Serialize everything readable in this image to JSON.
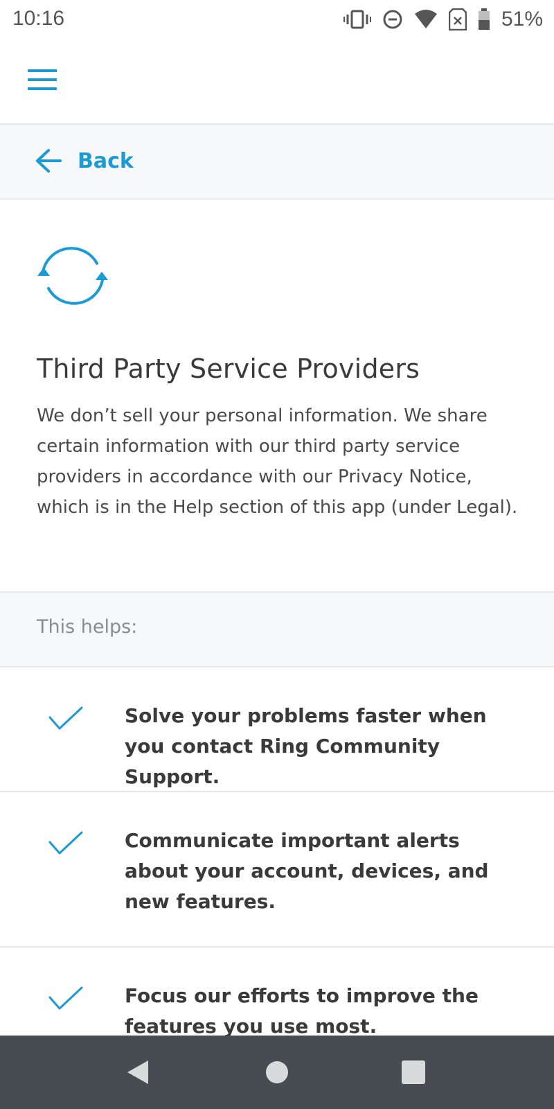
{
  "status_bar": {
    "time": "10:16",
    "battery": "51%",
    "icons": [
      "vibrate-icon",
      "do-not-disturb-icon",
      "wifi-icon",
      "no-sim-icon",
      "battery-icon"
    ]
  },
  "app_bar": {
    "menu_icon": "hamburger-menu-icon"
  },
  "back_bar": {
    "label": "Back",
    "icon": "arrow-left-icon"
  },
  "intro": {
    "icon": "sync-icon",
    "title": "Third Party Service Providers",
    "description": "We don’t sell your personal information. We share certain information with our third party service providers in accordance with our Privacy Notice, which is in the Help section of this app (under Legal)."
  },
  "helps": {
    "label": "This helps:",
    "items": [
      {
        "text": "Solve your problems faster when you contact Ring Community Support.",
        "icon": "checkmark-icon"
      },
      {
        "text": "Communicate important alerts about your account, devices, and new features.",
        "icon": "checkmark-icon"
      },
      {
        "text": "Focus our efforts to improve the features you use most.",
        "icon": "checkmark-icon"
      }
    ]
  },
  "nav_bar": {
    "buttons": [
      "back-triangle-icon",
      "home-circle-icon",
      "recents-square-icon"
    ]
  },
  "colors": {
    "accent": "#1c9ad6",
    "nav_bar": "#464c51",
    "section_bg": "#f7f8fa",
    "divider": "#e6e8ea"
  }
}
